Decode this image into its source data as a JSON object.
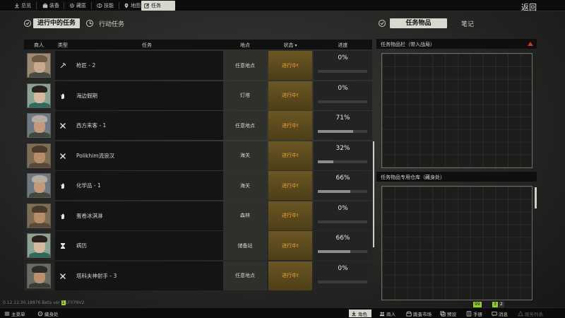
{
  "top_nav": {
    "tabs": [
      {
        "label": "总览",
        "icon": "download-icon"
      },
      {
        "label": "装备",
        "icon": "briefcase-icon"
      },
      {
        "label": "藏匿",
        "icon": "gear-icon"
      },
      {
        "label": "技能",
        "icon": "brain-icon"
      },
      {
        "label": "地图",
        "icon": "map-pin-icon"
      },
      {
        "label": "任务",
        "icon": "edit-icon",
        "active": true
      }
    ],
    "back_label": "返回"
  },
  "sub_header": {
    "active_tab": "进行中的任务",
    "action_tab": "行动任务",
    "items_tab": "任务物品",
    "notes_tab": "笔记"
  },
  "quest_table": {
    "headers": {
      "trader": "商人",
      "type": "类型",
      "quest": "任务",
      "location": "地点",
      "status": "状态",
      "progress": "进度"
    },
    "rows": [
      {
        "trader": "mechanic",
        "type_icon": "pickaxe-icon",
        "name": "枪匠 - 2",
        "location": "任意地点",
        "status": "进行中!",
        "progress_text": "0%",
        "progress": 0
      },
      {
        "trader": "therapist",
        "type_icon": "hand-icon",
        "name": "海边假期",
        "location": "灯塔",
        "status": "进行中!",
        "progress_text": "0%",
        "progress": 0
      },
      {
        "trader": "prapor",
        "type_icon": "crossed-swords-icon",
        "name": "西方来客 - 1",
        "location": "任意地点",
        "status": "进行中!",
        "progress_text": "71%",
        "progress": 0.71
      },
      {
        "trader": "skier",
        "type_icon": "crossed-swords-icon",
        "name": "Polikhim流浪汉",
        "location": "海关",
        "status": "进行中!",
        "progress_text": "32%",
        "progress": 0.32
      },
      {
        "trader": "prapor",
        "type_icon": "hand-icon",
        "name": "化学品 - 1",
        "location": "海关",
        "status": "进行中!",
        "progress_text": "66%",
        "progress": 0.66
      },
      {
        "trader": "skier",
        "type_icon": "hand-icon",
        "name": "蛋卷冰淇淋",
        "location": "森林",
        "status": "进行中!",
        "progress_text": "0%",
        "progress": 0
      },
      {
        "trader": "therapist",
        "type_icon": "hourglass-icon",
        "name": "病历",
        "location": "储备站",
        "status": "进行中!",
        "progress_text": "66%",
        "progress": 0.66
      },
      {
        "trader": "jaeger",
        "type_icon": "crossed-swords-icon",
        "name": "塔科夫神射手 - 3",
        "location": "任意地点",
        "status": "进行中!",
        "progress_text": "0%",
        "progress": 0
      }
    ]
  },
  "right_panel": {
    "items_title": "任务物品栏（带入战局）",
    "stash_title": "任务物品专用仓库（藏身处）"
  },
  "bottom_bar": {
    "version_text": "0.12.12.30.18876 Beta ver",
    "version_code": "LF07NV2",
    "left_items": [
      {
        "label": "主菜单",
        "icon": "menu-icon"
      },
      {
        "label": "藏身处",
        "icon": "hideout-icon"
      }
    ],
    "right_items": [
      {
        "label": "角色",
        "icon": "download-icon",
        "active": true
      },
      {
        "label": "商人",
        "icon": "people-icon"
      },
      {
        "label": "跳蚤市场",
        "icon": "market-icon"
      },
      {
        "label": "预设",
        "icon": "copy-icon"
      },
      {
        "label": "手册",
        "icon": "book-icon"
      },
      {
        "label": "消息",
        "icon": "message-icon"
      },
      {
        "label": "服务列表",
        "icon": "server-icon"
      }
    ],
    "stat_value_1": "99",
    "stat_value_2": "3",
    "stat_value_3": "2"
  },
  "colors": {
    "status_text": "#f2a93b",
    "status_bg": "#5b4a1d",
    "active_pill": "#d9d8d0",
    "green_stat": "#8fcf2a"
  }
}
